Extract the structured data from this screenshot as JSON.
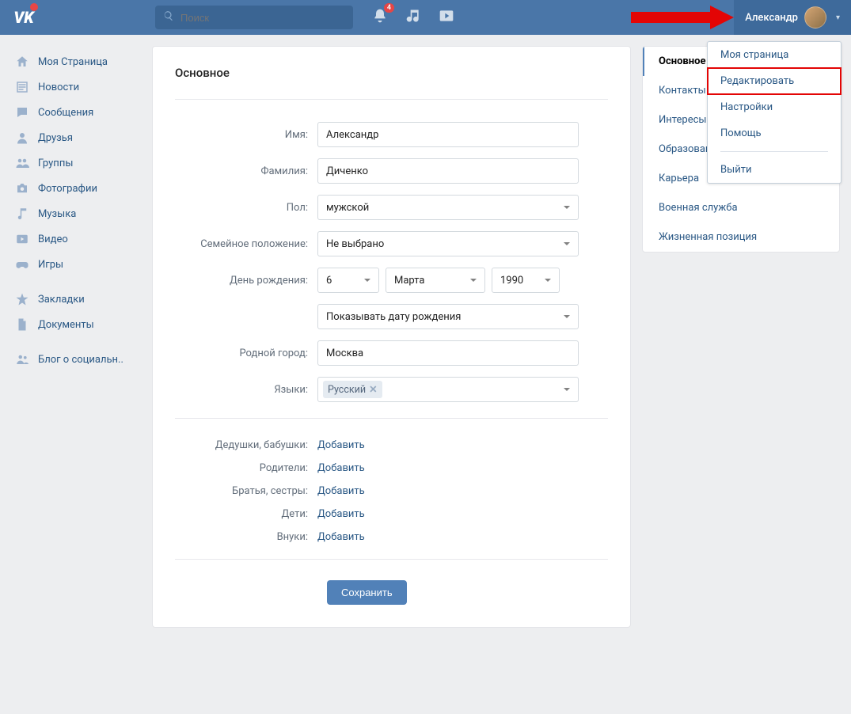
{
  "header": {
    "search_placeholder": "Поиск",
    "notif_count": "4",
    "user_name": "Александр"
  },
  "left_nav": [
    {
      "key": "my-page",
      "label": "Моя Страница",
      "icon": "home"
    },
    {
      "key": "news",
      "label": "Новости",
      "icon": "news"
    },
    {
      "key": "messages",
      "label": "Сообщения",
      "icon": "chat"
    },
    {
      "key": "friends",
      "label": "Друзья",
      "icon": "user"
    },
    {
      "key": "groups",
      "label": "Группы",
      "icon": "group"
    },
    {
      "key": "photos",
      "label": "Фотографии",
      "icon": "camera"
    },
    {
      "key": "music",
      "label": "Музыка",
      "icon": "music"
    },
    {
      "key": "video",
      "label": "Видео",
      "icon": "video"
    },
    {
      "key": "games",
      "label": "Игры",
      "icon": "gamepad"
    }
  ],
  "left_nav2": [
    {
      "key": "bookmarks",
      "label": "Закладки",
      "icon": "star"
    },
    {
      "key": "docs",
      "label": "Документы",
      "icon": "doc"
    }
  ],
  "left_nav3": [
    {
      "key": "blog",
      "label": "Блог о социальн..",
      "icon": "people"
    }
  ],
  "page": {
    "title": "Основное",
    "labels": {
      "first_name": "Имя:",
      "last_name": "Фамилия:",
      "sex": "Пол:",
      "relation": "Семейное положение:",
      "birthday": "День рождения:",
      "hometown": "Родной город:",
      "languages": "Языки:",
      "grandparents": "Дедушки, бабушки:",
      "parents": "Родители:",
      "siblings": "Братья, сестры:",
      "children": "Дети:",
      "grandchildren": "Внуки:"
    },
    "values": {
      "first_name": "Александр",
      "last_name": "Диченко",
      "sex": "мужской",
      "relation": "Не выбрано",
      "bday_day": "6",
      "bday_month": "Марта",
      "bday_year": "1990",
      "bday_visibility": "Показывать дату рождения",
      "hometown": "Москва",
      "language_tag": "Русский"
    },
    "add_link": "Добавить",
    "save": "Сохранить"
  },
  "right_tabs": [
    {
      "key": "main",
      "label": "Основное",
      "active": true
    },
    {
      "key": "contacts",
      "label": "Контакты"
    },
    {
      "key": "interests",
      "label": "Интересы"
    },
    {
      "key": "education",
      "label": "Образование"
    },
    {
      "key": "career",
      "label": "Карьера"
    },
    {
      "key": "military",
      "label": "Военная служба"
    },
    {
      "key": "life",
      "label": "Жизненная позиция"
    }
  ],
  "dropdown": {
    "my_page": "Моя страница",
    "edit": "Редактировать",
    "settings": "Настройки",
    "help": "Помощь",
    "logout": "Выйти"
  }
}
